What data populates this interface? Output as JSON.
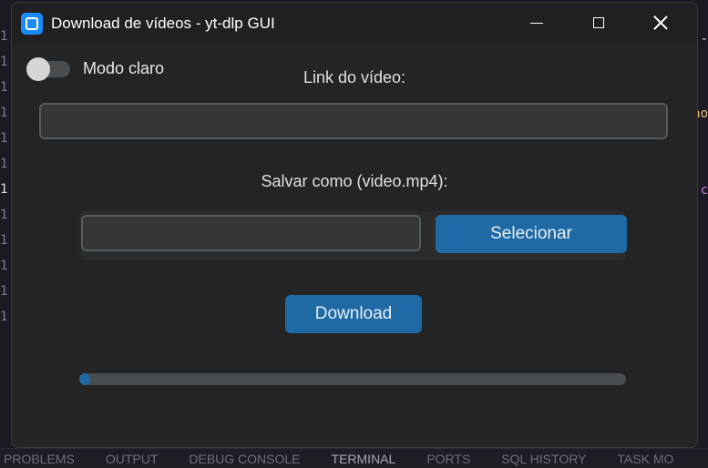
{
  "window": {
    "title": "Download de vídeos - yt-dlp GUI",
    "minimize_icon": "minimize-icon",
    "maximize_icon": "maximize-icon",
    "close_icon": "close-icon"
  },
  "theme_toggle": {
    "label": "Modo claro",
    "checked": false
  },
  "link": {
    "label": "Link do vídeo:",
    "value": ""
  },
  "save": {
    "label": "Salvar como (video.mp4):",
    "value": "",
    "select_label": "Selecionar"
  },
  "download": {
    "label": "Download"
  },
  "progress": {
    "fraction": 0.02
  },
  "colors": {
    "accent": "#1f6aa5",
    "window_bg": "#242424",
    "field_bg": "#343638"
  },
  "background_panel": {
    "tabs": [
      "PROBLEMS",
      "OUTPUT",
      "DEBUG CONSOLE",
      "TERMINAL",
      "PORTS",
      "SQL HISTORY",
      "TASK MO"
    ],
    "active_tab": "TERMINAL"
  }
}
